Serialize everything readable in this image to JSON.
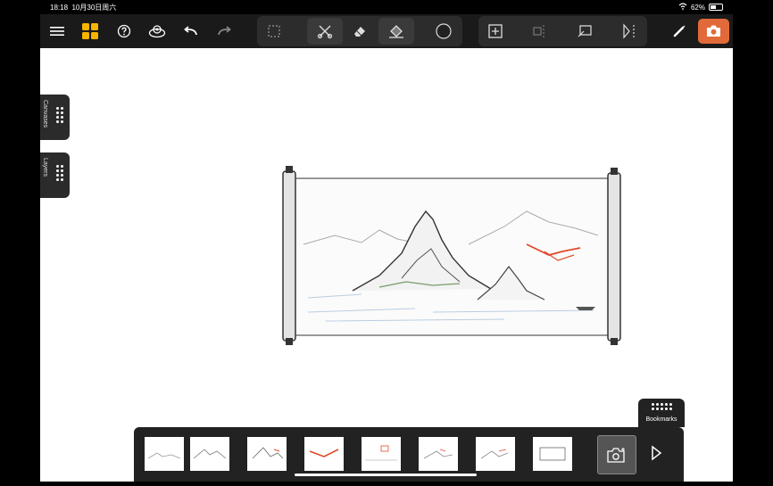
{
  "status_bar": {
    "time": "18:18",
    "date": "10月30日周六",
    "battery": "62%",
    "battery_level": 0.62
  },
  "toolbar": {
    "left_icons": [
      "menu-icon",
      "gallery-grid-icon",
      "help-icon",
      "stencil-icon",
      "undo-icon",
      "redo-icon"
    ],
    "tool_group_icons": [
      "selection-icon",
      "lasso-cut-icon",
      "eraser-icon",
      "fill-icon",
      "color-swatch-icon"
    ],
    "edit_group_icons": [
      "add-canvas-icon",
      "mirror-icon",
      "layer-transform-icon",
      "symmetry-icon"
    ],
    "brand_color": "#1a1a1a",
    "yellow": "#f5b400",
    "orange": "#e2693a"
  },
  "side_tabs": {
    "canvases": "Canvases",
    "layers": "Layers"
  },
  "bookmarks": {
    "label": "Bookmarks"
  },
  "filmstrip": {
    "count": 8
  }
}
